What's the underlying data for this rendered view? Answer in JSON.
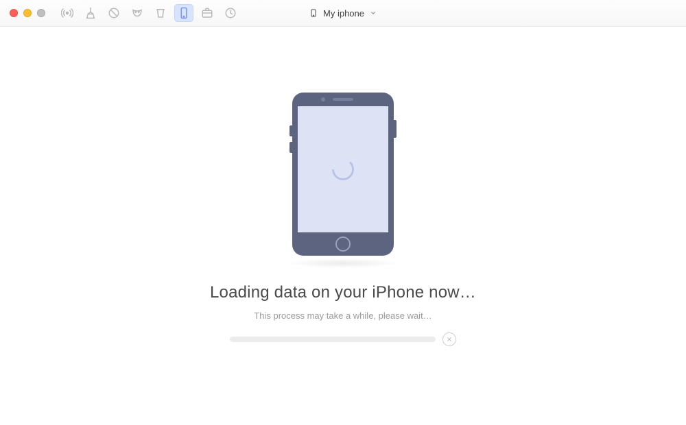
{
  "window": {
    "device_label": "My iphone"
  },
  "toolbar": {
    "icons": [
      "broadcast-icon",
      "clean-icon",
      "clock-icon",
      "mask-icon",
      "cup-icon",
      "device-icon",
      "briefcase-icon",
      "history-icon"
    ],
    "selected_index": 5
  },
  "status": {
    "headline": "Loading data on your iPhone now…",
    "subline": "This process may take a while, please wait…"
  }
}
